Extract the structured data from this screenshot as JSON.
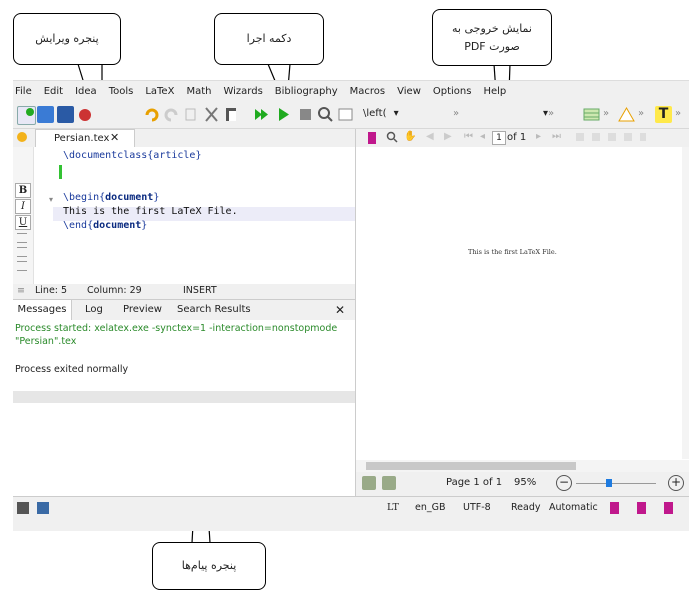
{
  "callouts": {
    "editor_window": "پنجره ویرایش",
    "run_button": "دکمه اجرا",
    "pdf_output_line1": "نمایش خروجی به",
    "pdf_output_line2": "صورت PDF",
    "messages_window": "پنجره پیام‌ها"
  },
  "menu": [
    "File",
    "Edit",
    "Idea",
    "Tools",
    "LaTeX",
    "Math",
    "Wizards",
    "Bibliography",
    "Macros",
    "View",
    "Options",
    "Help"
  ],
  "toolbar": {
    "left_delim": "\\left(",
    "dropdown_arrow": "▾",
    "overflow": "»"
  },
  "editor": {
    "tab_label": "Persian.tex",
    "tab_close": "✕",
    "format_buttons": [
      "B",
      "I",
      "U"
    ],
    "lines": [
      {
        "text": "\\documentclass{article}"
      },
      {
        "text": ""
      },
      {
        "text": ""
      },
      {
        "text": "\\begin{document}"
      },
      {
        "text": "This is the first LaTeX File."
      },
      {
        "text": "\\end{document}"
      }
    ],
    "status": {
      "line": "Line: 5",
      "column": "Column: 29",
      "mode": "INSERT"
    }
  },
  "messages": {
    "tabs": [
      "Messages",
      "Log",
      "Preview",
      "Search Results"
    ],
    "close": "✕",
    "line1": "Process started: xelatex.exe -synctex=1 -interaction=nonstopmode",
    "line2": "\"Persian\".tex",
    "line3": "Process exited normally"
  },
  "viewer": {
    "page_input": "1",
    "page_of": "of 1",
    "pdf_text": "This is the first LaTeX File.",
    "page_label": "Page 1 of 1",
    "zoom": "95%"
  },
  "statusbar": {
    "lt": "LT",
    "language": "en_GB",
    "encoding": "UTF-8",
    "ready": "Ready",
    "automatic": "Automatic"
  },
  "colors": {
    "run_green": "#1faa1f",
    "code_blue": "#1a3a9c",
    "message_green": "#2a8a2a",
    "accent_blue": "#1e7be0",
    "bookmark_magenta": "#c0188c"
  }
}
